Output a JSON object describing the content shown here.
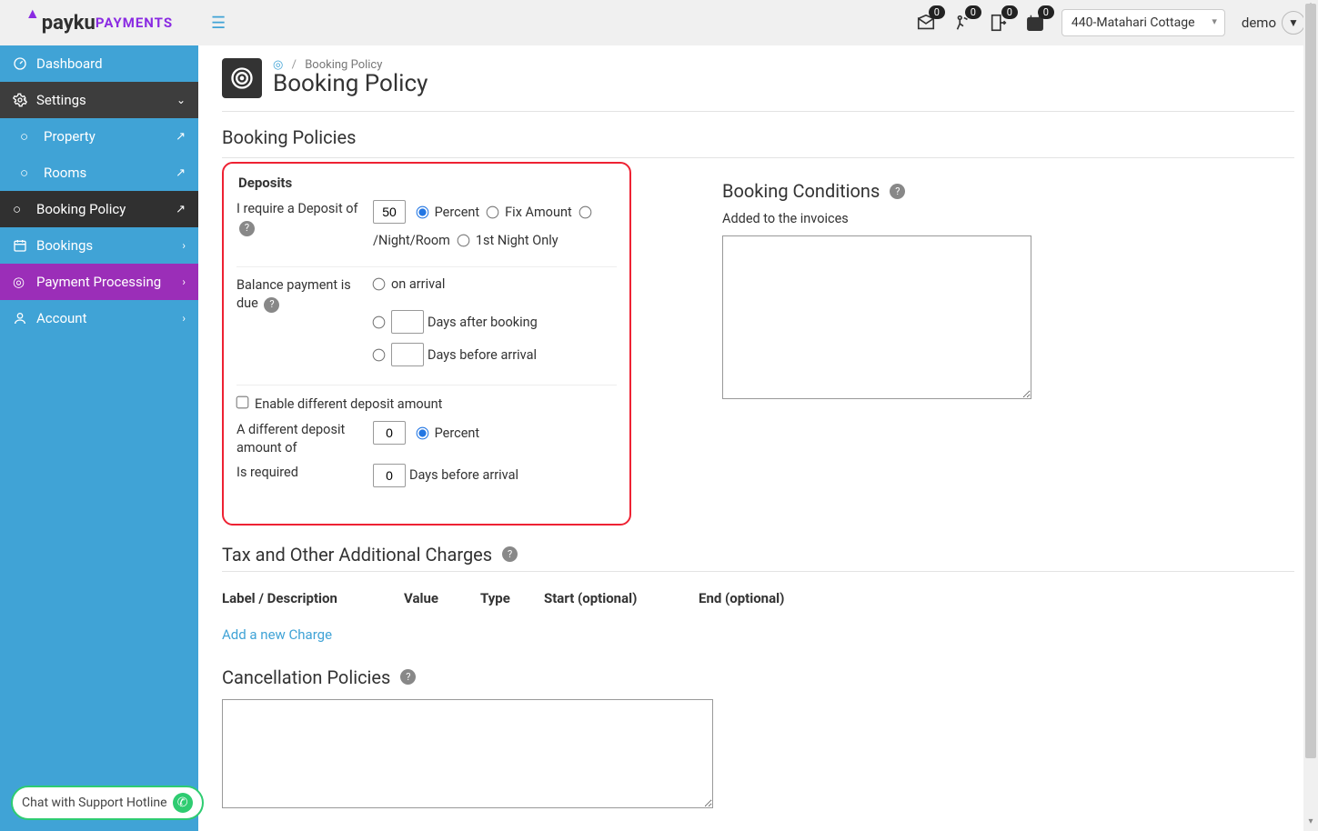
{
  "logo": {
    "prefix": "pay",
    "suffix": "ku",
    "brand": "PAYMENTS"
  },
  "nav": {
    "dashboard": "Dashboard",
    "settings": "Settings",
    "property": "Property",
    "rooms": "Rooms",
    "booking_policy": "Booking Policy",
    "bookings": "Bookings",
    "payment_processing": "Payment Processing",
    "account": "Account"
  },
  "chat_label": "Chat with Support Hotline",
  "topbar": {
    "badges": {
      "mail": "0",
      "group": "0",
      "depart": "0",
      "calendar": "0"
    },
    "property": "440-Matahari Cottage",
    "user": "demo"
  },
  "breadcrumb": {
    "home_icon": "◎",
    "current": "Booking Policy"
  },
  "page_title": "Booking Policy",
  "section_policies": "Booking Policies",
  "deposits": {
    "legend": "Deposits",
    "require_label": "I require a Deposit of",
    "require_value": "50",
    "opt_percent": "Percent",
    "opt_fix": "Fix Amount",
    "opt_night": "/Night/Room",
    "opt_first": "1st Night Only",
    "balance_label": "Balance payment is due",
    "opt_arrival": "on arrival",
    "days_after_value": "",
    "opt_days_after": "Days after booking",
    "days_before_value": "",
    "opt_days_before": "Days before arrival",
    "enable_diff": "Enable different deposit amount",
    "diff_label": "A different deposit amount of",
    "diff_value": "0",
    "diff_percent": "Percent",
    "required_label": "Is required",
    "required_value": "0",
    "required_suffix": "Days before arrival"
  },
  "conditions": {
    "title": "Booking Conditions",
    "desc": "Added to the invoices",
    "value": ""
  },
  "tax": {
    "title": "Tax and Other Additional Charges",
    "cols": {
      "c1": "Label / Description",
      "c2": "Value",
      "c3": "Type",
      "c4": "Start (optional)",
      "c5": "End (optional)"
    },
    "add_link": "Add a new Charge"
  },
  "cancel": {
    "title": "Cancellation Policies",
    "value": ""
  }
}
